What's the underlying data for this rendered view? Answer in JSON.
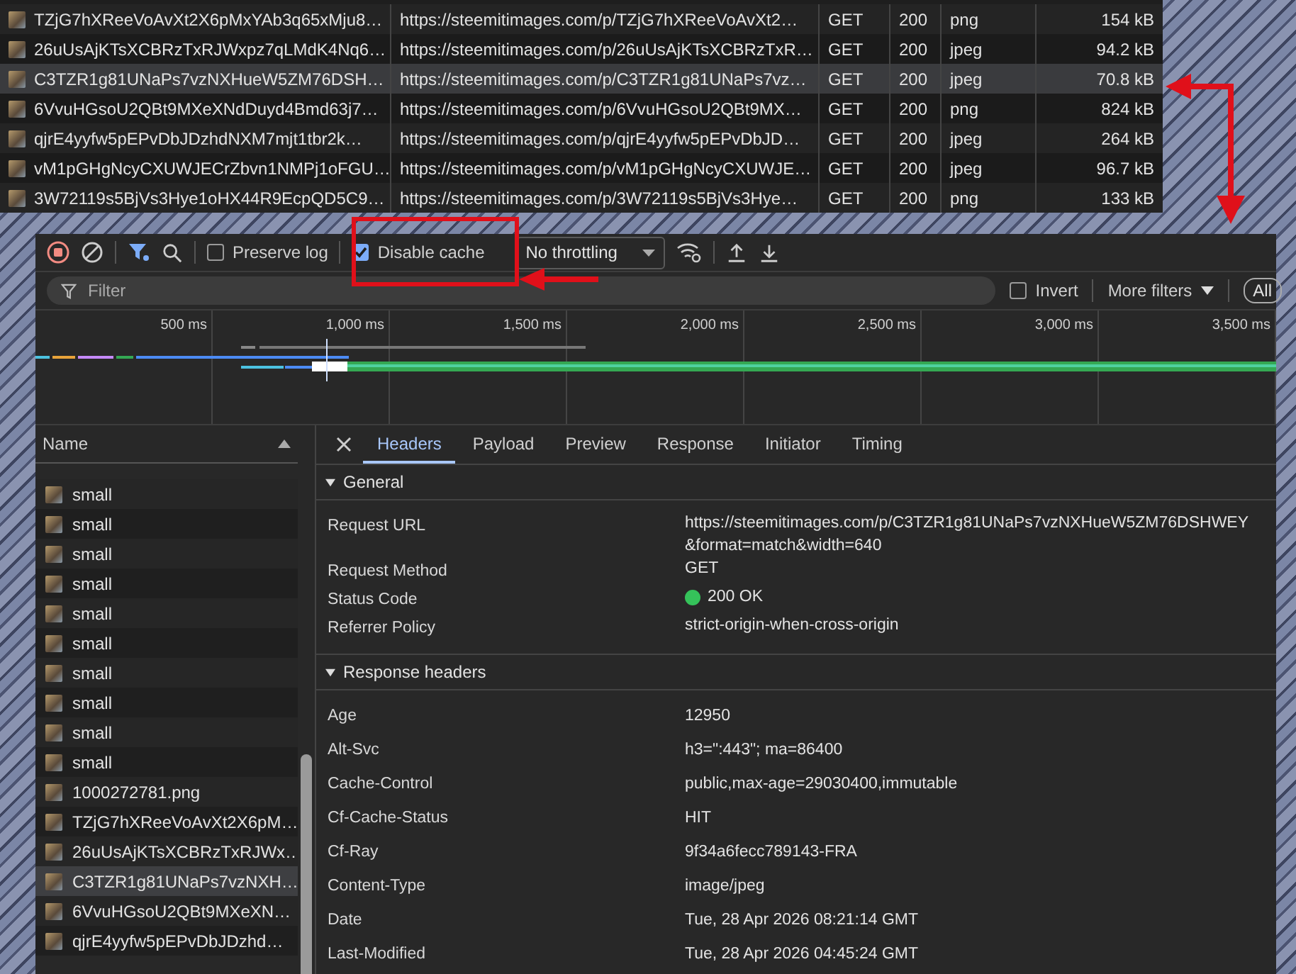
{
  "requests_table": {
    "rows": [
      {
        "name": "TZjG7hXReeVoAvXt2X6pMxYAb3q65xMju8…",
        "url": "https://steemitimages.com/p/TZjG7hXReeVoAvXt2…",
        "method": "GET",
        "status": "200",
        "type": "png",
        "size": "154 kB",
        "selected": false
      },
      {
        "name": "26uUsAjKTsXCBRzTxRJWxpz7qLMdK4Nq6…",
        "url": "https://steemitimages.com/p/26uUsAjKTsXCBRzTxR…",
        "method": "GET",
        "status": "200",
        "type": "jpeg",
        "size": "94.2 kB",
        "selected": false
      },
      {
        "name": "C3TZR1g81UNaPs7vzNXHueW5ZM76DSH…",
        "url": "https://steemitimages.com/p/C3TZR1g81UNaPs7vz…",
        "method": "GET",
        "status": "200",
        "type": "jpeg",
        "size": "70.8 kB",
        "selected": true
      },
      {
        "name": "6VvuHGsoU2QBt9MXeXNdDuyd4Bmd63j7…",
        "url": "https://steemitimages.com/p/6VvuHGsoU2QBt9MX…",
        "method": "GET",
        "status": "200",
        "type": "png",
        "size": "824 kB",
        "selected": false
      },
      {
        "name": "qjrE4yyfw5pEPvDbJDzhdNXM7mjt1tbr2k…",
        "url": "https://steemitimages.com/p/qjrE4yyfw5pEPvDbJD…",
        "method": "GET",
        "status": "200",
        "type": "jpeg",
        "size": "264 kB",
        "selected": false
      },
      {
        "name": "vM1pGHgNcyCXUWJECrZbvn1NMPj1oFGU…",
        "url": "https://steemitimages.com/p/vM1pGHgNcyCXUWJE…",
        "method": "GET",
        "status": "200",
        "type": "jpeg",
        "size": "96.7 kB",
        "selected": false
      },
      {
        "name": "3W72119s5BjVs3Hye1oHX44R9EcpQD5C9…",
        "url": "https://steemitimages.com/p/3W72119s5BjVs3Hye…",
        "method": "GET",
        "status": "200",
        "type": "png",
        "size": "133 kB",
        "selected": false
      }
    ]
  },
  "toolbar": {
    "preserve_log": {
      "label": "Preserve log",
      "checked": false
    },
    "disable_cache": {
      "label": "Disable cache",
      "checked": true
    },
    "throttling": "No throttling"
  },
  "filter_bar": {
    "placeholder": "Filter",
    "invert": {
      "label": "Invert",
      "checked": false
    },
    "more_filters": "More filters",
    "all": "All"
  },
  "timeline": {
    "ticks": [
      "500 ms",
      "1,000 ms",
      "1,500 ms",
      "2,000 ms",
      "2,500 ms",
      "3,000 ms",
      "3,500 ms"
    ]
  },
  "name_list": {
    "header": "Name",
    "items": [
      {
        "name": "small",
        "selected": false
      },
      {
        "name": "small",
        "selected": false
      },
      {
        "name": "small",
        "selected": false
      },
      {
        "name": "small",
        "selected": false
      },
      {
        "name": "small",
        "selected": false
      },
      {
        "name": "small",
        "selected": false
      },
      {
        "name": "small",
        "selected": false
      },
      {
        "name": "small",
        "selected": false
      },
      {
        "name": "small",
        "selected": false
      },
      {
        "name": "small",
        "selected": false
      },
      {
        "name": "1000272781.png",
        "selected": false
      },
      {
        "name": "TZjG7hXReeVoAvXt2X6pM…",
        "selected": false
      },
      {
        "name": "26uUsAjKTsXCBRzTxRJWx…",
        "selected": false
      },
      {
        "name": "C3TZR1g81UNaPs7vzNXH…",
        "selected": true
      },
      {
        "name": "6VvuHGsoU2QBt9MXeXN…",
        "selected": false
      },
      {
        "name": "qjrE4yyfw5pEPvDbJDzhd…",
        "selected": false
      }
    ]
  },
  "details": {
    "tabs": [
      {
        "label": "Headers",
        "selected": true
      },
      {
        "label": "Payload",
        "selected": false
      },
      {
        "label": "Preview",
        "selected": false
      },
      {
        "label": "Response",
        "selected": false
      },
      {
        "label": "Initiator",
        "selected": false
      },
      {
        "label": "Timing",
        "selected": false
      }
    ],
    "sections": [
      {
        "title": "General",
        "expanded": true,
        "rows": [
          {
            "label": "Request URL",
            "value": "https://steemitimages.com/p/C3TZR1g81UNaPs7vzNXHueW5ZM76DSHWEY",
            "value_2": "&format=match&width=640"
          },
          {
            "label": "Request Method",
            "value": "GET"
          },
          {
            "label": "Status Code",
            "value": "200 OK",
            "kind": "status"
          },
          {
            "label": "Referrer Policy",
            "value": "strict-origin-when-cross-origin"
          }
        ]
      },
      {
        "title": "Response headers",
        "expanded": true,
        "rows": [
          {
            "label": "Age",
            "value": "12950"
          },
          {
            "label": "Alt-Svc",
            "value": "h3=\":443\"; ma=86400"
          },
          {
            "label": "Cache-Control",
            "value": "public,max-age=29030400,immutable"
          },
          {
            "label": "Cf-Cache-Status",
            "value": "HIT"
          },
          {
            "label": "Cf-Ray",
            "value": "9f34a6fecc789143-FRA"
          },
          {
            "label": "Content-Type",
            "value": "image/jpeg"
          },
          {
            "label": "Date",
            "value": "Tue, 28 Apr 2026 08:21:14 GMT"
          },
          {
            "label": "Last-Modified",
            "value": "Tue, 28 Apr 2026 04:45:24 GMT"
          }
        ]
      }
    ]
  }
}
